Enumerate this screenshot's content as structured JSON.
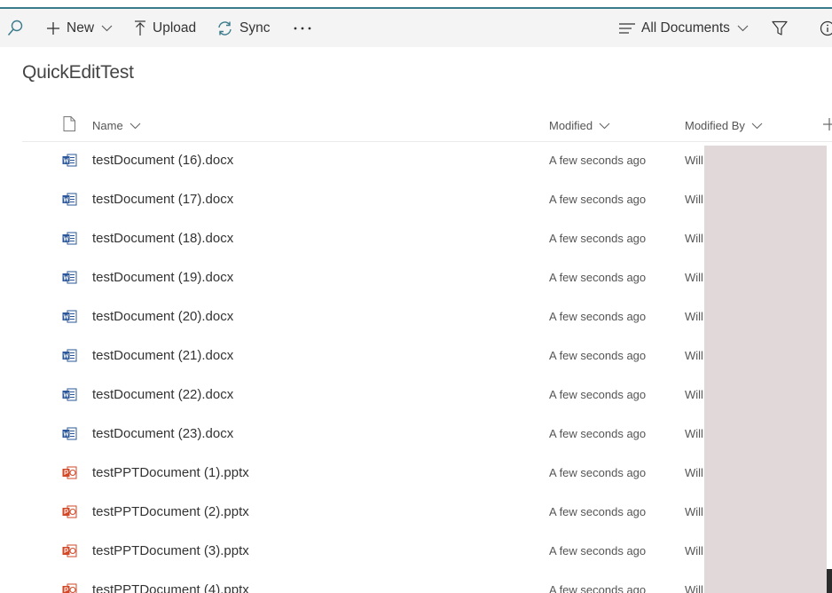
{
  "toolbar": {
    "new_label": "New",
    "upload_label": "Upload",
    "sync_label": "Sync",
    "view_label": "All Documents"
  },
  "library_title": "QuickEditTest",
  "columns": {
    "name": "Name",
    "modified": "Modified",
    "modified_by": "Modified By"
  },
  "files": [
    {
      "name": "testDocument (16).docx",
      "modified": "A few seconds ago",
      "modified_by": "Will",
      "type": "word"
    },
    {
      "name": "testDocument (17).docx",
      "modified": "A few seconds ago",
      "modified_by": "Will",
      "type": "word"
    },
    {
      "name": "testDocument (18).docx",
      "modified": "A few seconds ago",
      "modified_by": "Will",
      "type": "word"
    },
    {
      "name": "testDocument (19).docx",
      "modified": "A few seconds ago",
      "modified_by": "Will",
      "type": "word"
    },
    {
      "name": "testDocument (20).docx",
      "modified": "A few seconds ago",
      "modified_by": "Will",
      "type": "word"
    },
    {
      "name": "testDocument (21).docx",
      "modified": "A few seconds ago",
      "modified_by": "Will",
      "type": "word"
    },
    {
      "name": "testDocument (22).docx",
      "modified": "A few seconds ago",
      "modified_by": "Will",
      "type": "word"
    },
    {
      "name": "testDocument (23).docx",
      "modified": "A few seconds ago",
      "modified_by": "Will",
      "type": "word"
    },
    {
      "name": "testPPTDocument (1).pptx",
      "modified": "A few seconds ago",
      "modified_by": "Will",
      "type": "powerpoint"
    },
    {
      "name": "testPPTDocument (2).pptx",
      "modified": "A few seconds ago",
      "modified_by": "Will",
      "type": "powerpoint"
    },
    {
      "name": "testPPTDocument (3).pptx",
      "modified": "A few seconds ago",
      "modified_by": "Will",
      "type": "powerpoint"
    },
    {
      "name": "testPPTDocument (4).pptx",
      "modified": "A few seconds ago",
      "modified_by": "Will",
      "type": "powerpoint"
    }
  ],
  "icons": {
    "search": "search-icon",
    "new": "plus-icon",
    "upload": "upload-arrow-icon",
    "sync": "sync-icon",
    "more": "ellipsis-icon",
    "view": "list-lines-icon",
    "filter": "filter-funnel-icon",
    "info": "info-icon",
    "file_type_header": "document-outline-icon",
    "add_column": "plus-icon"
  },
  "colors": {
    "accent": "#3a7b8c",
    "word": "#2b579a",
    "powerpoint": "#d24726",
    "redaction": "#e1d9d9"
  }
}
